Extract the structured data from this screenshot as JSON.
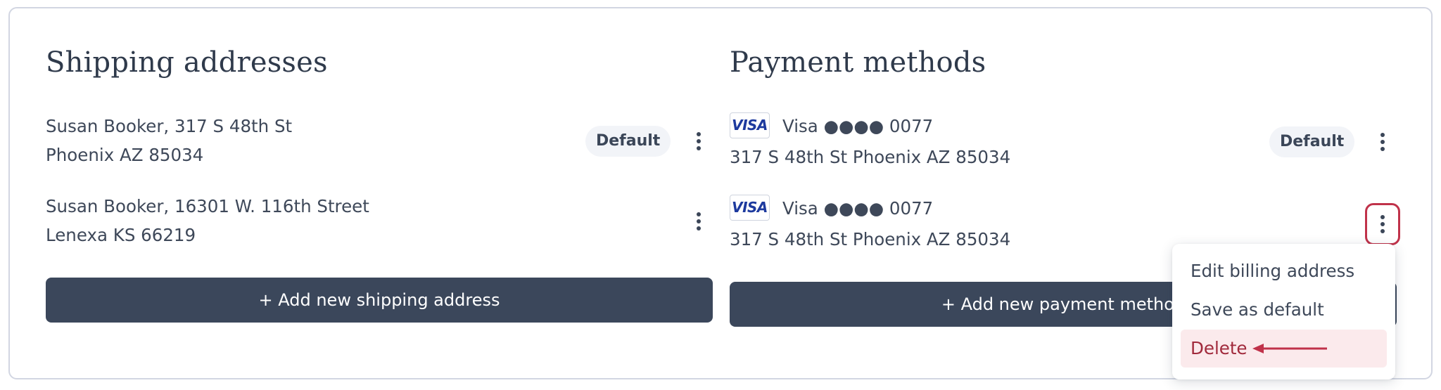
{
  "shipping": {
    "title": "Shipping addresses",
    "addresses": [
      {
        "line1": "Susan Booker, 317 S 48th St",
        "line2": "Phoenix AZ 85034",
        "badge": "Default"
      },
      {
        "line1": "Susan Booker, 16301 W. 116th Street",
        "line2": "Lenexa KS 66219"
      }
    ],
    "add_button": "+ Add new shipping address"
  },
  "payment": {
    "title": "Payment methods",
    "methods": [
      {
        "brand_logo": "VISA",
        "label": "Visa ●●●● 0077",
        "address": "317 S 48th St Phoenix AZ 85034",
        "badge": "Default"
      },
      {
        "brand_logo": "VISA",
        "label": "Visa ●●●● 0077",
        "address": "317 S 48th St Phoenix AZ 85034"
      }
    ],
    "add_button": "+ Add new payment method"
  },
  "menu": {
    "items": [
      "Edit billing address",
      "Save as default",
      "Delete"
    ]
  },
  "colors": {
    "primary_button": "#3b475b",
    "danger": "#c0324a",
    "danger_bg": "#fbeaec"
  }
}
